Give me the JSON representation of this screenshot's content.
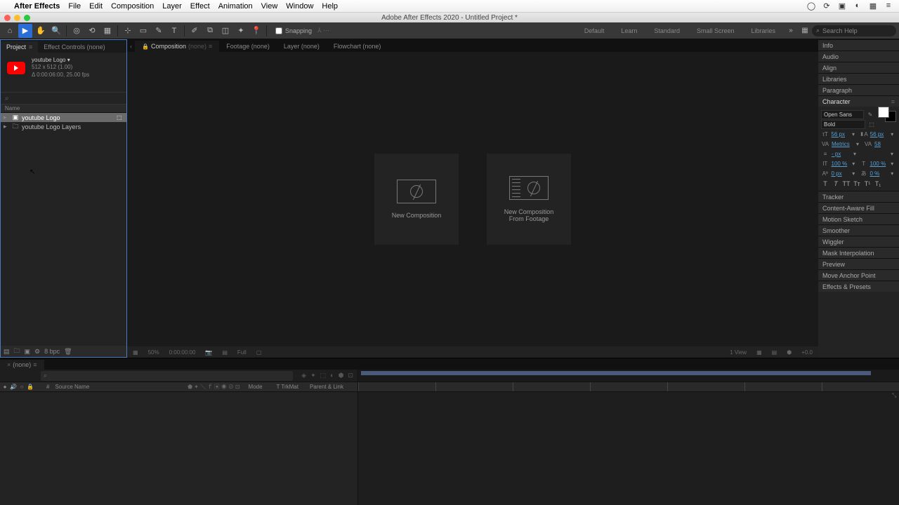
{
  "mac_menu": {
    "app": "After Effects",
    "items": [
      "File",
      "Edit",
      "Composition",
      "Layer",
      "Effect",
      "Animation",
      "View",
      "Window",
      "Help"
    ]
  },
  "window_title": "Adobe After Effects 2020 - Untitled Project *",
  "toolbar": {
    "snapping_label": "Snapping"
  },
  "workspaces": [
    "Default",
    "Learn",
    "Standard",
    "Small Screen",
    "Libraries"
  ],
  "search_placeholder": "Search Help",
  "project_panel": {
    "tabs": {
      "project": "Project",
      "effect_controls": "Effect Controls (none)"
    },
    "selected": {
      "name": "youtube Logo ▾",
      "line1": "512 x 512 (1.00)",
      "line2": "Δ 0:00:06:00, 25.00 fps"
    },
    "col_header": "Name",
    "items": [
      {
        "name": "youtube Logo",
        "type": "comp",
        "selected": true
      },
      {
        "name": "youtube Logo Layers",
        "type": "folder",
        "selected": false
      }
    ],
    "bottom_bpc": "8 bpc"
  },
  "viewer": {
    "tabs": {
      "composition": "Composition",
      "composition_suffix": "(none)",
      "footage": "Footage (none)",
      "layer": "Layer (none)",
      "flowchart": "Flowchart (none)"
    },
    "cards": {
      "new_comp": "New Composition",
      "from_footage_l1": "New Composition",
      "from_footage_l2": "From Footage"
    },
    "bottom": {
      "zoom": "50%",
      "time": "0:00:00:00",
      "res": "Full",
      "views": "1 View",
      "exposure": "+0.0"
    }
  },
  "right_panels": {
    "collapsed": [
      "Info",
      "Audio",
      "Align",
      "Libraries",
      "Paragraph"
    ],
    "character": {
      "title": "Character",
      "font": "Open Sans",
      "weight": "Bold",
      "size": "56 px",
      "leading": "56 px",
      "kerning": "Metrics",
      "tracking": "58",
      "line_unit": "- px",
      "hscale": "100 %",
      "vscale": "100 %",
      "baseline": "0 px",
      "tsume": "0 %"
    },
    "below": [
      "Tracker",
      "Content-Aware Fill",
      "Motion Sketch",
      "Smoother",
      "Wiggler",
      "Mask Interpolation",
      "Preview",
      "Move Anchor Point",
      "Effects & Presets"
    ]
  },
  "timeline": {
    "tab": "(none)",
    "cols": {
      "source": "Source Name",
      "mode": "Mode",
      "trkmat": "TrkMat",
      "parent": "Parent & Link"
    }
  }
}
